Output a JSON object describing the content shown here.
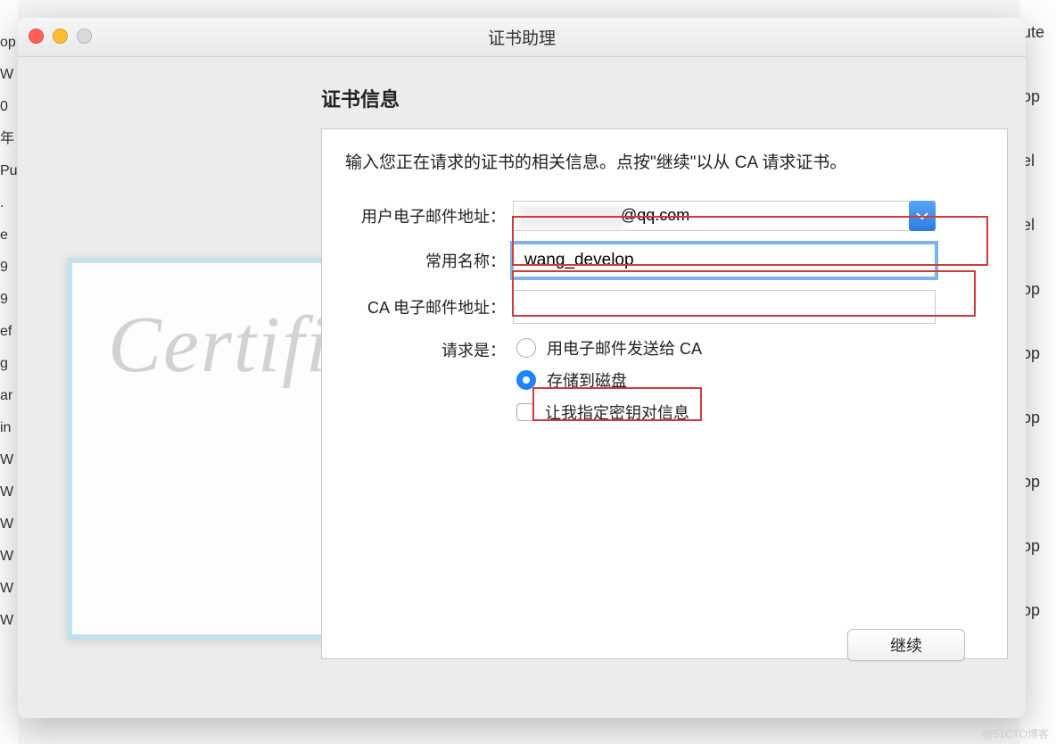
{
  "window": {
    "title": "证书助理"
  },
  "section": {
    "heading": "证书信息",
    "instruction": "输入您正在请求的证书的相关信息。点按\"继续\"以从 CA 请求证书。"
  },
  "form": {
    "email_label": "用户电子邮件地址：",
    "email_visible_suffix": "@qq.com",
    "name_label": "常用名称：",
    "name_value": "wang_develop",
    "ca_email_label": "CA 电子邮件地址：",
    "ca_email_value": "",
    "request_label": "请求是：",
    "radio_email_ca": "用电子邮件发送给 CA",
    "radio_save_disk": "存储到磁盘",
    "check_keypair": "让我指定密钥对信息"
  },
  "buttons": {
    "continue": "继续"
  },
  "certificate_graphic": {
    "script_text": "Certificate"
  },
  "bg": {
    "left": [
      "op",
      "W",
      "0年",
      "",
      "Pu",
      ".",
      "e",
      "",
      "9",
      "9",
      "ef",
      "g",
      "ar",
      "in",
      "W",
      "W",
      "W",
      "W",
      "W",
      "W"
    ],
    "right": [
      "ute",
      "op",
      "el",
      "el",
      "op",
      "op",
      "op",
      "op",
      "op",
      "op"
    ]
  },
  "watermark": "@51CTO博客"
}
